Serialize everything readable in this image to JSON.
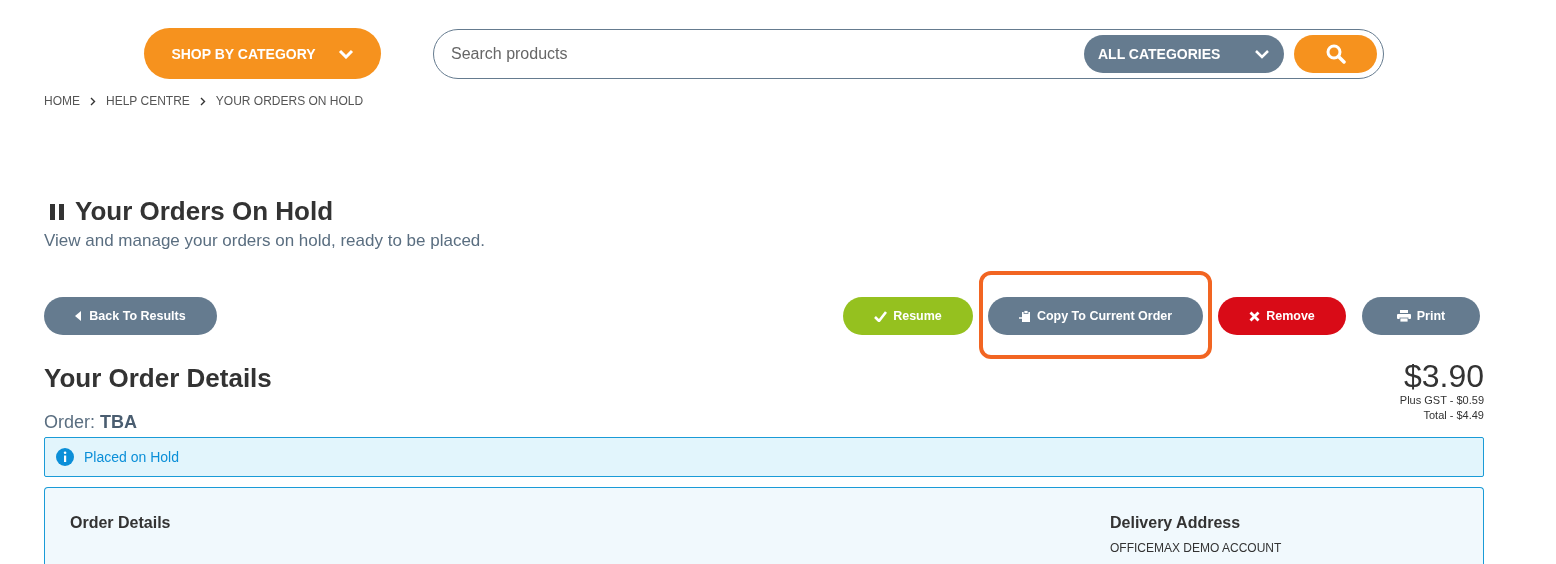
{
  "header": {
    "shop_button": "SHOP BY CATEGORY",
    "search": {
      "placeholder": "Search products",
      "category": "ALL CATEGORIES"
    }
  },
  "breadcrumb": [
    "HOME",
    "HELP CENTRE",
    "YOUR ORDERS ON HOLD"
  ],
  "page": {
    "title": "Your Orders On Hold",
    "subtitle": "View and manage your orders on hold, ready to be placed."
  },
  "back_button": "Back To Results",
  "actions": [
    {
      "label": "Resume",
      "kind": "success",
      "highlighted": false
    },
    {
      "label": "Copy To Current Order",
      "kind": "secondary",
      "highlighted": true
    },
    {
      "label": "Remove",
      "kind": "danger",
      "highlighted": false
    },
    {
      "label": "Print",
      "kind": "print",
      "highlighted": false
    }
  ],
  "order": {
    "heading": "Your Order Details",
    "label": "Order:",
    "number": "TBA",
    "price": "$3.90",
    "gst": "Plus GST -  $0.59",
    "total": "Total - $4.49"
  },
  "alert": "Placed on Hold",
  "card": {
    "left_heading": "Order Details",
    "right_heading": "Delivery Address",
    "address_line": "OFFICEMAX DEMO ACCOUNT"
  }
}
